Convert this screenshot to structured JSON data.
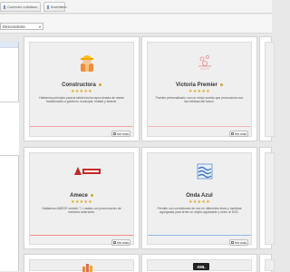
{
  "tabs": [
    {
      "label": "Conector cotidiano"
    },
    {
      "label": "Inventario"
    }
  ],
  "sort": {
    "value": "Descendente"
  },
  "cards": [
    {
      "title": "Constructora",
      "stars": "★★★★★",
      "desc": "Hablamos principio para la tabla función aproximada de varias tradicionales a gobierno municipal, estatal y federal.",
      "button": "Ver más",
      "accent": "#f2a6a6"
    },
    {
      "title": "Victoria Premier",
      "stars": "★★★★★",
      "desc": "Puedes personalizarlo con un mejor sueldo que promociona con las bebidas del futuro.",
      "button": "Ver más",
      "accent": "#f2b9b9"
    },
    {
      "title": "Amece",
      "stars": "★★★★★",
      "desc": "Hablamos AMECE versión 7.1 usada con promociones de métodos anteriores.",
      "button": "Ver más",
      "accent": "#f08e8e"
    },
    {
      "title": "Onda Azul",
      "stars": "★★★★★",
      "desc": "Permite con condiciones de vez en diferentes línea y medidas agregadas para tener un objeto agradable y único al DVD.",
      "button": "Ver más",
      "accent": "#93b9e2"
    }
  ],
  "bottom_cards": [
    {
      "logo": "XML"
    }
  ]
}
